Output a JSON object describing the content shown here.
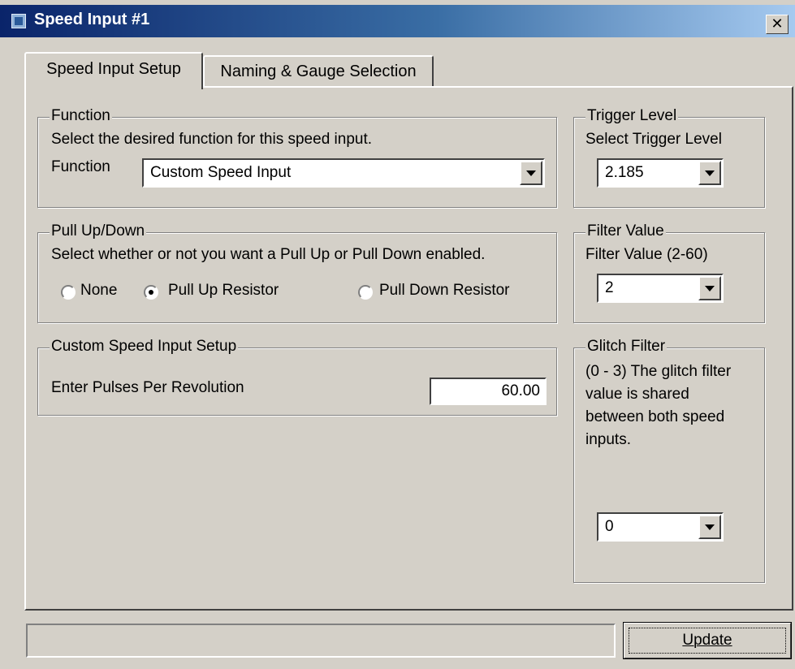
{
  "window": {
    "title": "Speed Input #1",
    "close_glyph": "✕"
  },
  "tabs": [
    {
      "label": "Speed Input Setup",
      "active": true
    },
    {
      "label": "Naming & Gauge Selection",
      "active": false
    }
  ],
  "function_group": {
    "label": "Function",
    "description": "Select the desired function for this speed input.",
    "field_label": "Function",
    "selected": "Custom Speed Input"
  },
  "pull_group": {
    "label": "Pull Up/Down",
    "description": "Select whether or not you want a Pull Up or Pull Down enabled.",
    "options": [
      {
        "label": "None",
        "checked": false
      },
      {
        "label": "Pull Up Resistor",
        "checked": true
      },
      {
        "label": "Pull Down Resistor",
        "checked": false
      }
    ]
  },
  "custom_group": {
    "label": "Custom Speed Input Setup",
    "field_label": "Enter Pulses Per Revolution",
    "value": "60.00"
  },
  "trigger_group": {
    "label": "Trigger Level",
    "description": "Select Trigger Level",
    "selected": "2.185"
  },
  "filter_group": {
    "label": "Filter Value",
    "description": "Filter Value (2-60)",
    "selected": "2"
  },
  "glitch_group": {
    "label": "Glitch Filter",
    "description_lines": [
      "(0 - 3) The glitch filter",
      "value is shared",
      "between both speed",
      "inputs."
    ],
    "selected": "0"
  },
  "footer": {
    "status_text": "",
    "update_label": "Update"
  },
  "colors": {
    "face": "#d4d0c8",
    "title_start": "#0a246a",
    "title_end": "#a6caf0"
  },
  "icons": {
    "app": "app-icon",
    "close": "close-icon",
    "dropdown": "chevron-down-icon"
  }
}
